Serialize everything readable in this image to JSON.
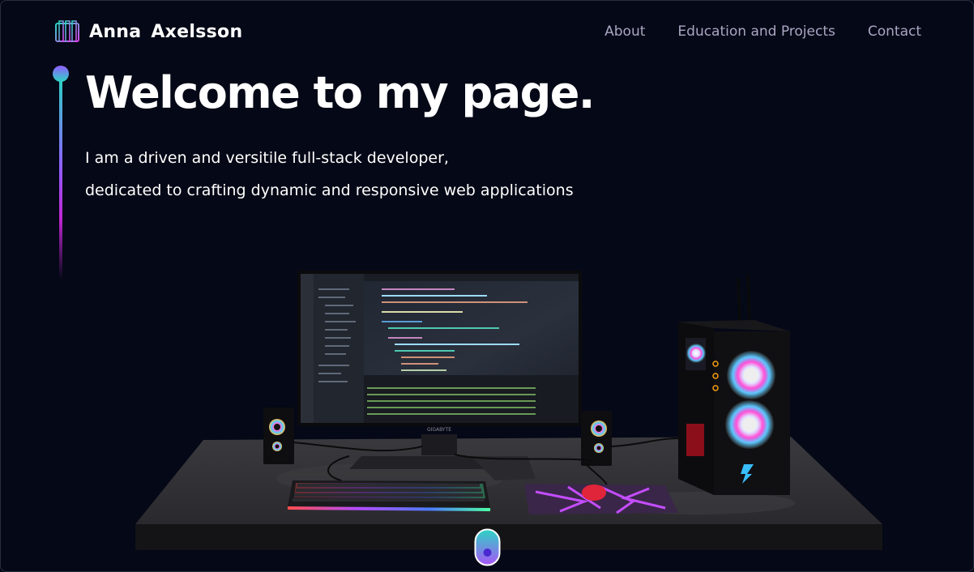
{
  "header": {
    "name": "Anna  Axelsson",
    "nav": [
      {
        "label": "About"
      },
      {
        "label": "Education and Projects"
      },
      {
        "label": "Contact"
      }
    ]
  },
  "hero": {
    "title": "Welcome to my page.",
    "line1": "I am a driven and versitile full-stack developer,",
    "line2": "dedicated to crafting dynamic and responsive web applications"
  },
  "scene": {
    "monitor_brand": "GIGABYTE"
  },
  "colors": {
    "background": "#050816",
    "nav_text": "#aaa6c3",
    "accent_purple": "#915eff",
    "accent_teal": "#2bd4c4"
  }
}
